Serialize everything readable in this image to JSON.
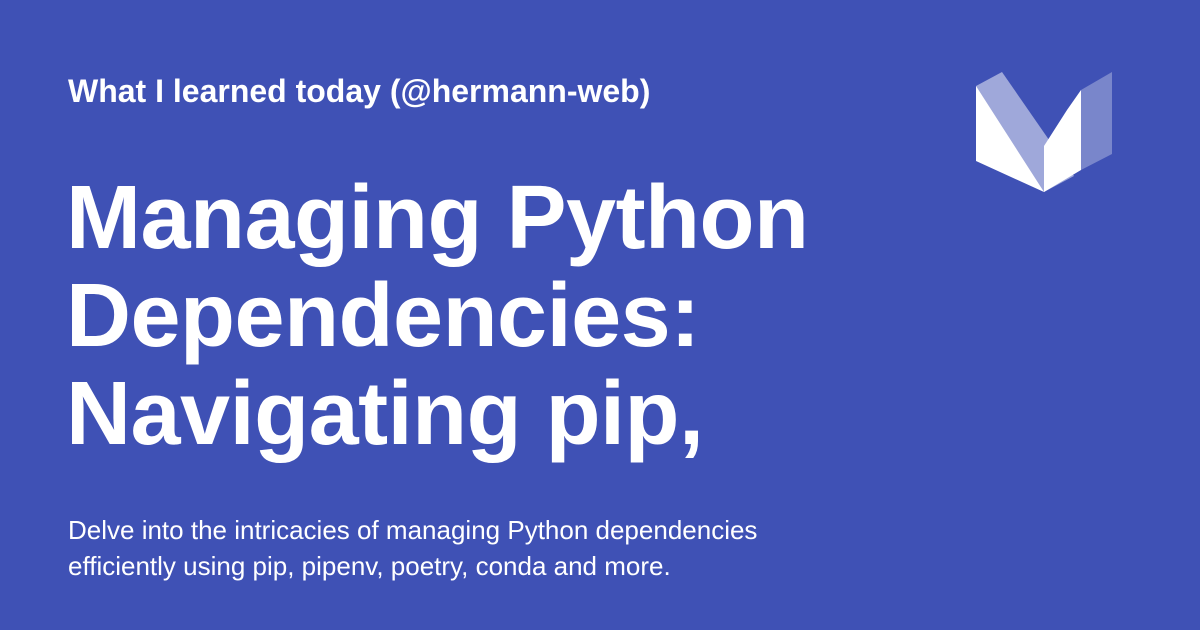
{
  "card": {
    "kicker": "What I learned today (@hermann-web)",
    "title_lines": [
      "Managing Python",
      "Dependencies:",
      "Navigating pip,"
    ],
    "description_lines": [
      "Delve into the intricacies of managing Python dependencies",
      "efficiently using pip, pipenv, poetry, conda and more."
    ]
  },
  "colors": {
    "background": "#3f51b5",
    "text": "#ffffff",
    "logo_light": "#ffffff",
    "logo_mid": "#9fa8da",
    "logo_dark": "#7986cb"
  },
  "icons": {
    "logo": "material-m-logo-icon"
  }
}
